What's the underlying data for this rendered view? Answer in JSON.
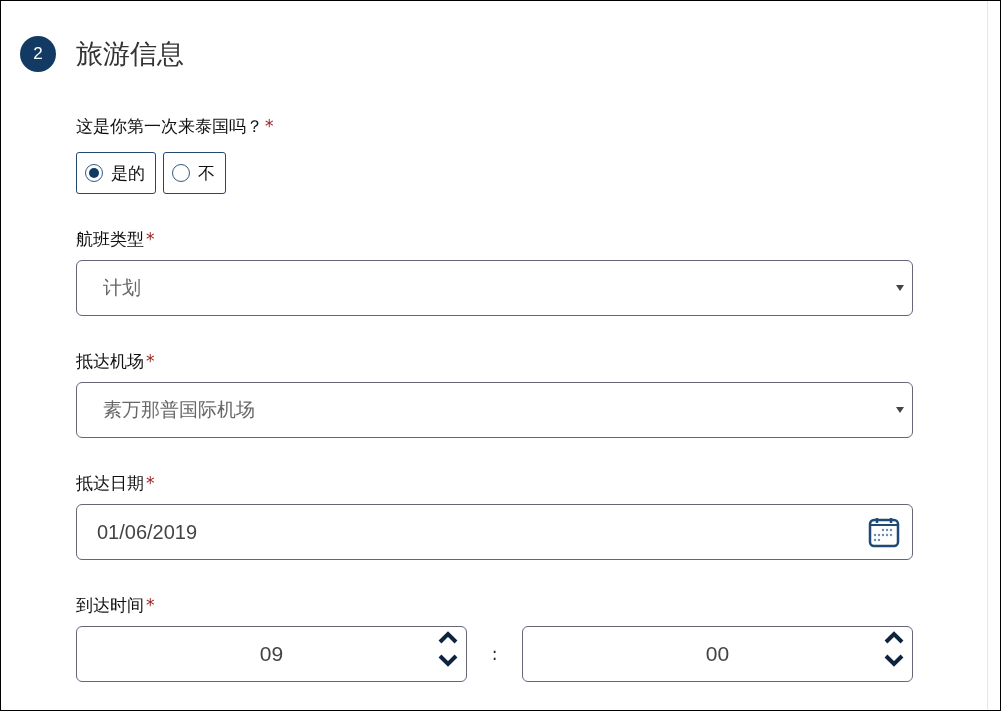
{
  "section": {
    "step": "2",
    "title": "旅游信息"
  },
  "fields": [
    {
      "kind": "radio",
      "label": "这是你第一次来泰国吗？",
      "required_mark": "*",
      "options": [
        {
          "label": "是的",
          "selected": true
        },
        {
          "label": "不",
          "selected": false
        }
      ]
    },
    {
      "kind": "select",
      "label": "航班类型",
      "required_mark": "*",
      "value": "计划"
    },
    {
      "kind": "select",
      "label": "抵达机场",
      "required_mark": "*",
      "value": "素万那普国际机场"
    },
    {
      "kind": "date",
      "label": "抵达日期",
      "required_mark": "*",
      "value": "01/06/2019"
    },
    {
      "kind": "time",
      "label": "到达时间",
      "required_mark": "*",
      "hour": "09",
      "separator": ":",
      "minute": "00"
    }
  ]
}
